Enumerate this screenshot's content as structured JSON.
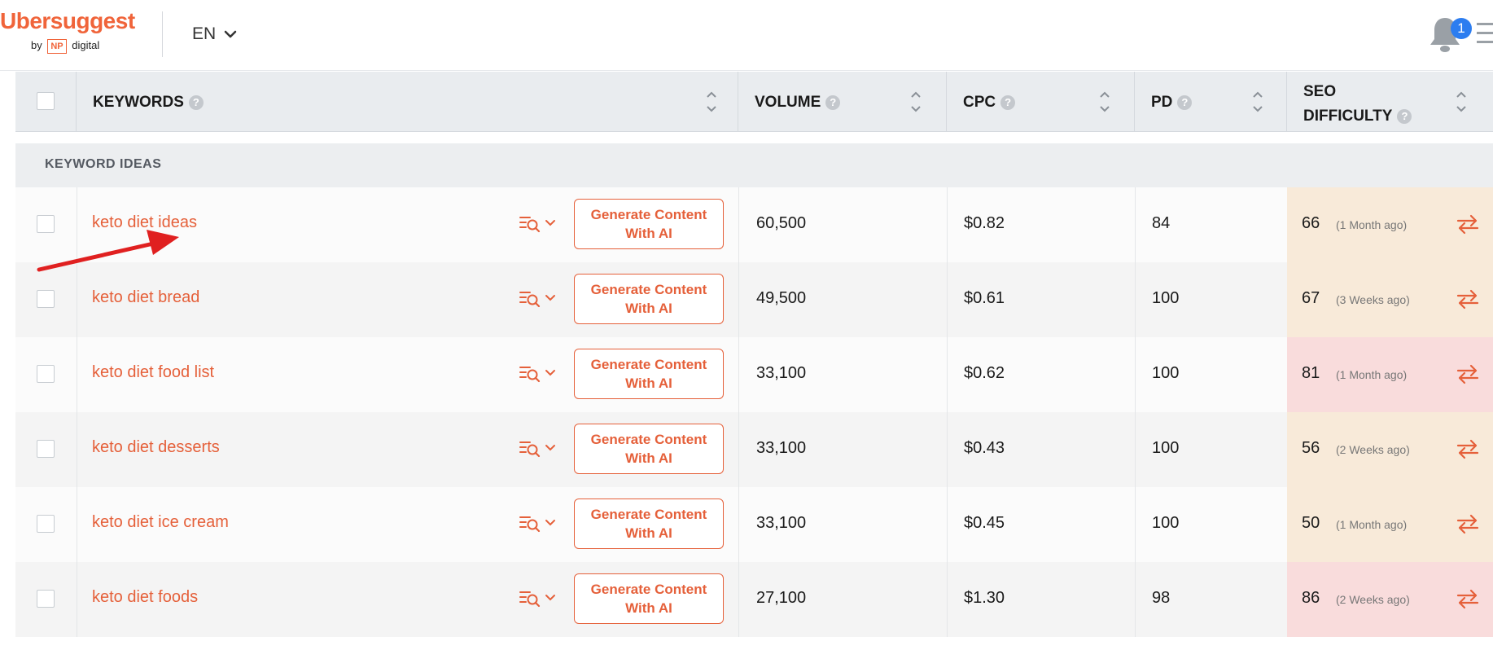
{
  "header": {
    "logo_text": "Ubersuggest",
    "logo_by": "by",
    "logo_np": "NP",
    "logo_digital": "digital",
    "language": "EN",
    "notification_count": "1"
  },
  "table": {
    "columns": {
      "keywords": "KEYWORDS",
      "volume": "VOLUME",
      "cpc": "CPC",
      "pd": "PD",
      "seo_difficulty_line1": "SEO",
      "seo_difficulty_line2": "DIFFICULTY"
    },
    "help_glyph": "?",
    "section_label": "KEYWORD IDEAS",
    "generate_btn_line1": "Generate Content",
    "generate_btn_line2": "With AI",
    "rows": [
      {
        "keyword": "keto diet ideas",
        "volume": "60,500",
        "cpc": "$0.82",
        "pd": "84",
        "sd": "66",
        "updated": "(1 Month ago)",
        "sd_color": "#f8ead9"
      },
      {
        "keyword": "keto diet bread",
        "volume": "49,500",
        "cpc": "$0.61",
        "pd": "100",
        "sd": "67",
        "updated": "(3 Weeks ago)",
        "sd_color": "#f8ead9"
      },
      {
        "keyword": "keto diet food list",
        "volume": "33,100",
        "cpc": "$0.62",
        "pd": "100",
        "sd": "81",
        "updated": "(1 Month ago)",
        "sd_color": "#f9dcdc"
      },
      {
        "keyword": "keto diet desserts",
        "volume": "33,100",
        "cpc": "$0.43",
        "pd": "100",
        "sd": "56",
        "updated": "(2 Weeks ago)",
        "sd_color": "#f8ead9"
      },
      {
        "keyword": "keto diet ice cream",
        "volume": "33,100",
        "cpc": "$0.45",
        "pd": "100",
        "sd": "50",
        "updated": "(1 Month ago)",
        "sd_color": "#f8ead9"
      },
      {
        "keyword": "keto diet foods",
        "volume": "27,100",
        "cpc": "$1.30",
        "pd": "98",
        "sd": "86",
        "updated": "(2 Weeks ago)",
        "sd_color": "#f9dcdc"
      }
    ]
  },
  "colors": {
    "brand_orange": "#e5603a",
    "annotation_red": "#e02020",
    "badge_blue": "#2c7df0"
  }
}
